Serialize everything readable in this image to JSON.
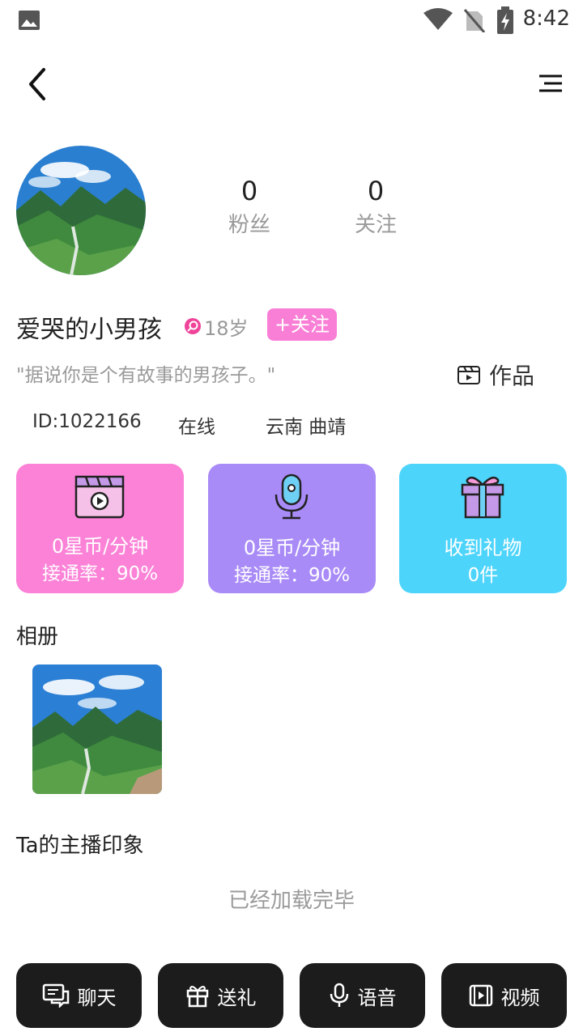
{
  "status_bar": {
    "time": "8:42",
    "icons": [
      "image-icon",
      "wifi-icon",
      "no-sim-icon",
      "battery-charging-icon"
    ]
  },
  "header": {
    "back_icon": "chevron-left-icon",
    "menu_icon": "menu-icon"
  },
  "profile": {
    "fans_count": "0",
    "fans_label": "粉丝",
    "following_count": "0",
    "following_label": "关注",
    "username": "爱哭的小男孩",
    "age": "18岁",
    "follow_button": "+关注",
    "signature": "\"据说你是个有故事的男孩子。\"",
    "works_label": "作品",
    "id_text": "ID:1022166",
    "online_status": "在线",
    "location": "云南 曲靖"
  },
  "cards": [
    {
      "icon": "video-clapper-icon",
      "line1": "0星币/分钟",
      "line2": "接通率：90%",
      "color": "#fb82d7"
    },
    {
      "icon": "microphone-icon",
      "line1": "0星币/分钟",
      "line2": "接通率：90%",
      "color": "#a98bf7"
    },
    {
      "icon": "gift-icon",
      "line1": "收到礼物",
      "line2": "0件",
      "color": "#4dd4fb"
    }
  ],
  "album": {
    "title": "相册"
  },
  "impression": {
    "title": "Ta的主播印象",
    "loaded_text": "已经加载完毕"
  },
  "bottom_bar": {
    "chat": "聊天",
    "gift": "送礼",
    "voice": "语音",
    "video": "视频"
  }
}
